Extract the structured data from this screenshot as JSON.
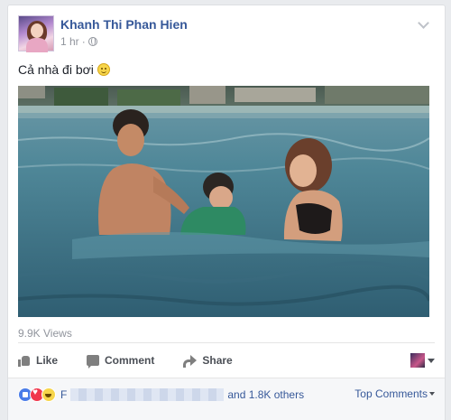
{
  "post": {
    "author": "Khanh Thi Phan Hien",
    "time": "1 hr",
    "separator": "·",
    "text": "Cả nhà đi bơi",
    "emoji": "smile-icon",
    "views": "9.9K Views"
  },
  "actions": {
    "like": "Like",
    "comment": "Comment",
    "share": "Share"
  },
  "reactions": {
    "icons": [
      "like",
      "love",
      "haha"
    ],
    "first_letter": "F",
    "others": "and 1.8K others"
  },
  "comments": {
    "sort_label": "Top Comments"
  },
  "colors": {
    "link": "#365899",
    "muted": "#90949c",
    "action": "#4b4f56"
  }
}
